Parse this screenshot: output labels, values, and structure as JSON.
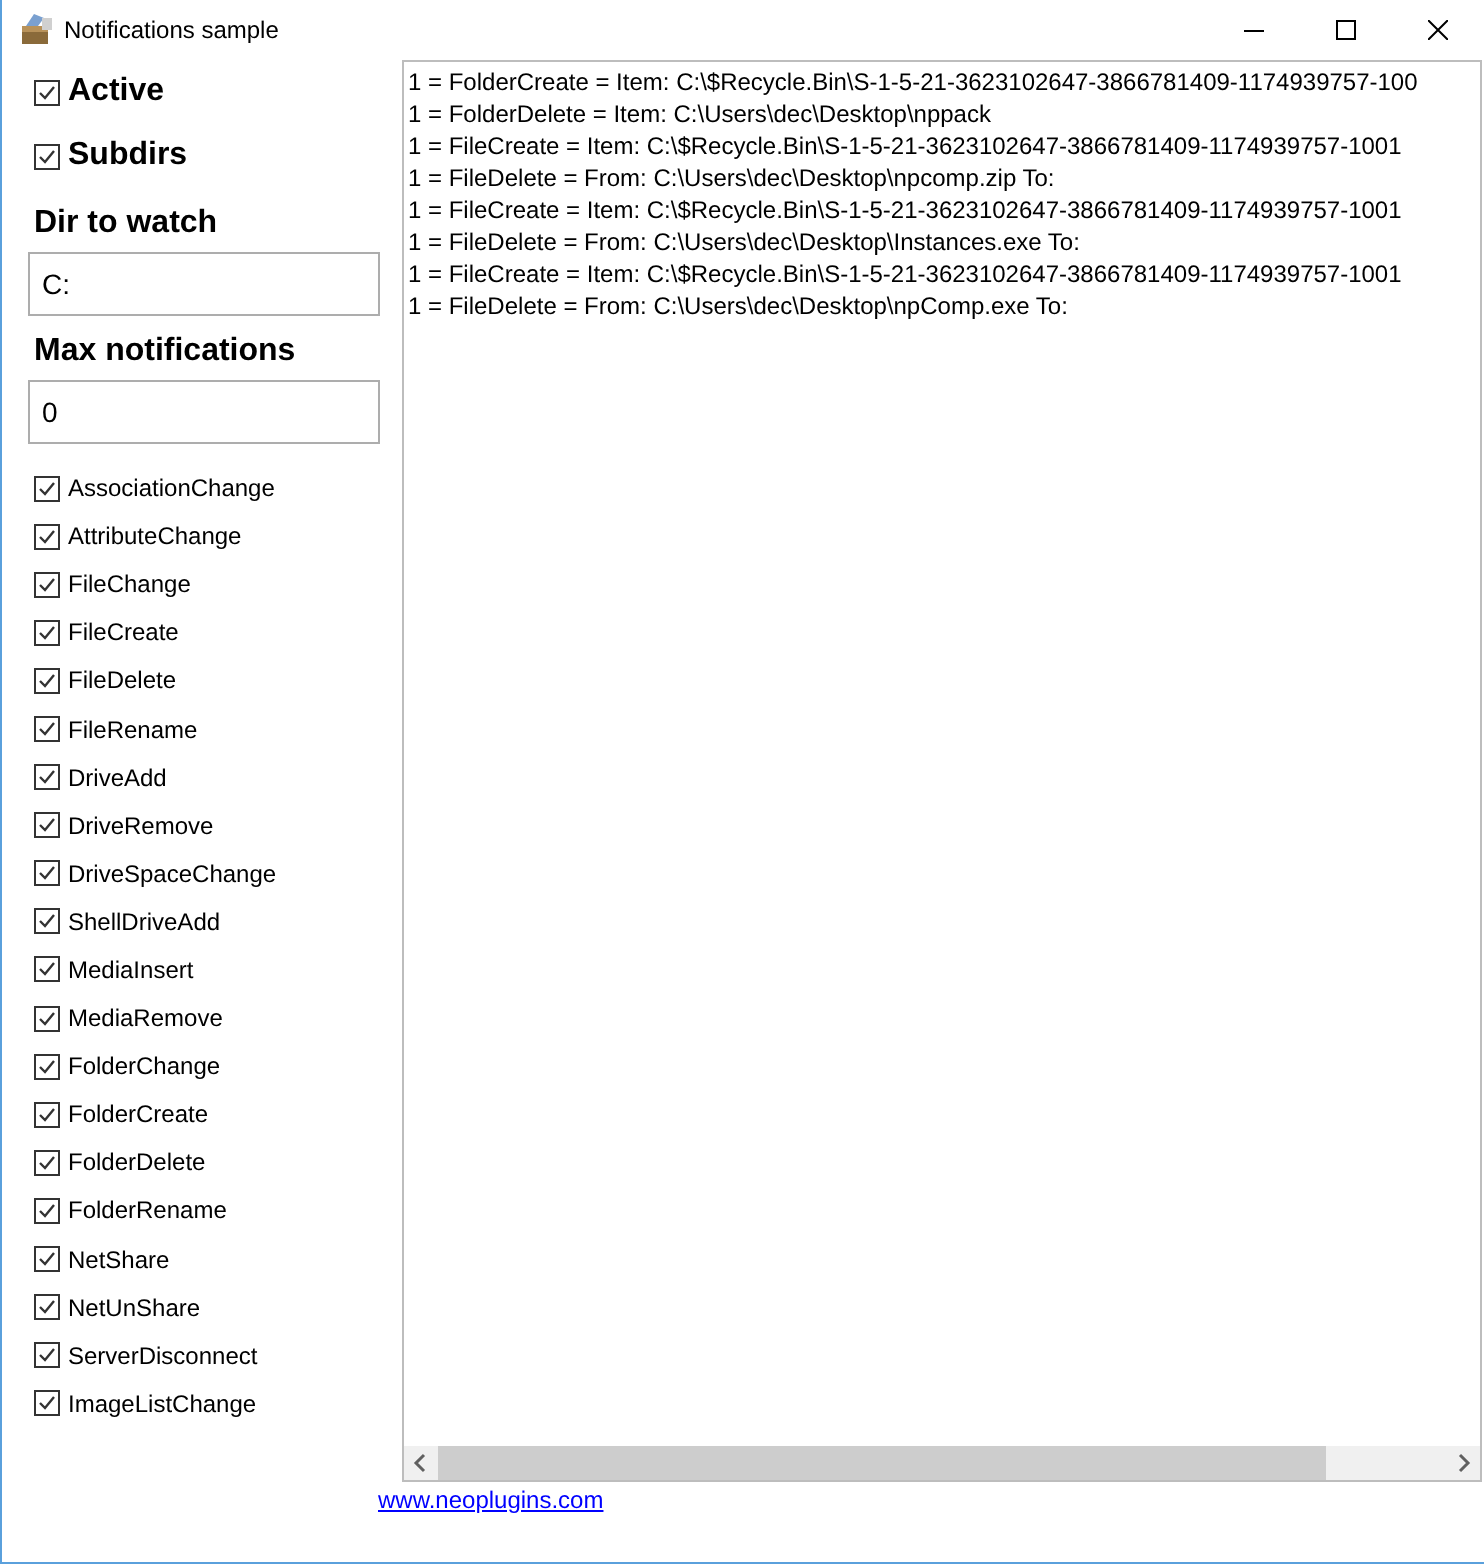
{
  "window": {
    "title": "Notifications sample"
  },
  "options": [
    {
      "label": "Active",
      "checked": true
    },
    {
      "label": "Subdirs",
      "checked": true
    }
  ],
  "fields": [
    {
      "label": "Dir to watch",
      "value": "C:"
    },
    {
      "label": "Max notifications",
      "value": "0"
    }
  ],
  "events": [
    {
      "label": "AssociationChange",
      "checked": true
    },
    {
      "label": "AttributeChange",
      "checked": true
    },
    {
      "label": "FileChange",
      "checked": true
    },
    {
      "label": "FileCreate",
      "checked": true
    },
    {
      "label": "FileDelete",
      "checked": true
    },
    {
      "label": "FileRename",
      "checked": true
    },
    {
      "label": "DriveAdd",
      "checked": true
    },
    {
      "label": "DriveRemove",
      "checked": true
    },
    {
      "label": "DriveSpaceChange",
      "checked": true
    },
    {
      "label": "ShellDriveAdd",
      "checked": true
    },
    {
      "label": "MediaInsert",
      "checked": true
    },
    {
      "label": "MediaRemove",
      "checked": true
    },
    {
      "label": "FolderChange",
      "checked": true
    },
    {
      "label": "FolderCreate",
      "checked": true
    },
    {
      "label": "FolderDelete",
      "checked": true
    },
    {
      "label": "FolderRename",
      "checked": true
    },
    {
      "label": "NetShare",
      "checked": true
    },
    {
      "label": "NetUnShare",
      "checked": true
    },
    {
      "label": "ServerDisconnect",
      "checked": true
    },
    {
      "label": "ImageListChange",
      "checked": true
    }
  ],
  "log": [
    "1 = FolderCreate = Item: C:\\$Recycle.Bin\\S-1-5-21-3623102647-3866781409-1174939757-100",
    "1 = FolderDelete = Item: C:\\Users\\dec\\Desktop\\nppack",
    "1 = FileCreate = Item: C:\\$Recycle.Bin\\S-1-5-21-3623102647-3866781409-1174939757-1001",
    "1 = FileDelete = From: C:\\Users\\dec\\Desktop\\npcomp.zip To:",
    "1 = FileCreate = Item: C:\\$Recycle.Bin\\S-1-5-21-3623102647-3866781409-1174939757-1001",
    "1 = FileDelete = From: C:\\Users\\dec\\Desktop\\Instances.exe To:",
    "1 = FileCreate = Item: C:\\$Recycle.Bin\\S-1-5-21-3623102647-3866781409-1174939757-1001",
    "1 = FileDelete = From: C:\\Users\\dec\\Desktop\\npComp.exe To:"
  ],
  "link": "www.neoplugins.com"
}
